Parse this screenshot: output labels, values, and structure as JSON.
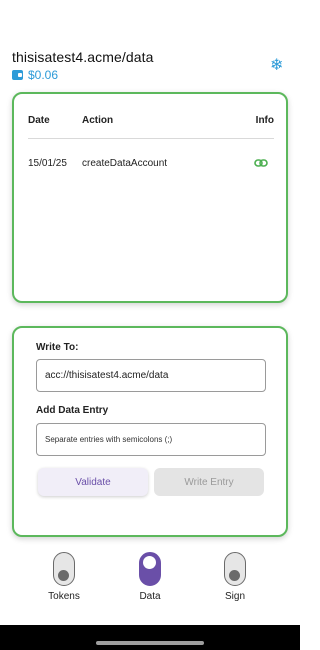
{
  "header": {
    "account_name": "thisisatest4.acme/data",
    "balance": "$0.06"
  },
  "history_table": {
    "columns": [
      "Date",
      "Action",
      "Info"
    ],
    "rows": [
      {
        "date": "15/01/25",
        "action": "createDataAccount",
        "info_icon": "link-icon"
      }
    ]
  },
  "write_form": {
    "write_to_label": "Write To:",
    "write_to_value": "acc://thisisatest4.acme/data",
    "add_entry_label": "Add Data Entry",
    "entry_placeholder": "Separate entries with semicolons (;)",
    "validate_label": "Validate",
    "write_entry_label": "Write Entry"
  },
  "tabs": [
    {
      "label": "Tokens",
      "active": false
    },
    {
      "label": "Data",
      "active": true
    },
    {
      "label": "Sign",
      "active": false
    }
  ],
  "colors": {
    "accent_blue": "#2d9bd8",
    "card_border_green": "#5cb85c",
    "primary_purple": "#6a4fa8"
  },
  "icons": {
    "wallet": "wallet-icon",
    "settings": "snowflake-icon",
    "link": "link-icon",
    "tab_toggle": "toggle-icon"
  }
}
